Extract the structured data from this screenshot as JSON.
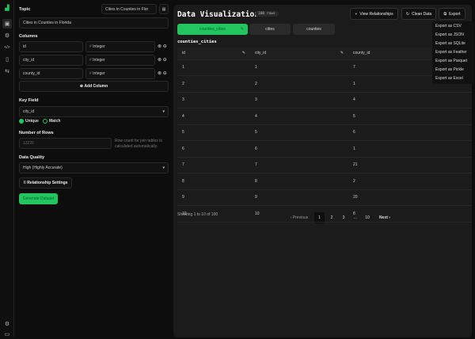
{
  "sidebar": {
    "icons": [
      "logo-icon",
      "terminal-icon",
      "robot-icon",
      "code-icon",
      "book-icon",
      "sliders-icon",
      "gear-icon",
      "panel-icon"
    ]
  },
  "config": {
    "topic_label": "Topic",
    "topic_select": "Cities in Counties in Flor",
    "topic_value": "Cities in Counties in Florida",
    "columns_label": "Columns",
    "columns": [
      {
        "name": "id",
        "type": "Integer"
      },
      {
        "name": "city_id",
        "type": "Integer"
      },
      {
        "name": "county_id",
        "type": "Integer"
      }
    ],
    "add_column": "Add Column",
    "key_field_label": "Key Field",
    "key_field_value": "city_id",
    "radio_unique": "Unique",
    "radio_match": "Match",
    "rows_label": "Number of Rows",
    "rows_placeholder": "13226",
    "rows_note": "Row count for join tables is calculated automatically.",
    "quality_label": "Data Quality",
    "quality_value": "High (Highly Accurate)",
    "relationship_settings": "Relationship Settings",
    "generate": "Generate Dataset"
  },
  "main": {
    "title": "Data Visualization",
    "rows_badge": "100 rows",
    "view_relationships": "View Relationships",
    "clean_data": "Clean Data",
    "export": "Export",
    "export_menu": [
      "Export as CSV",
      "Export as JSON",
      "Export as SQLite",
      "Export as Feather",
      "Export as Parquet",
      "Export as Pickle",
      "Export as Excel"
    ],
    "tabs": [
      "counties_cities",
      "cities",
      "counties"
    ],
    "table_title": "counties_cities",
    "headers": [
      "id",
      "city_id",
      "county_id"
    ],
    "rows": [
      [
        "1",
        "1",
        "7"
      ],
      [
        "2",
        "2",
        "1"
      ],
      [
        "3",
        "3",
        "4"
      ],
      [
        "4",
        "4",
        "5"
      ],
      [
        "5",
        "5",
        "6"
      ],
      [
        "6",
        "6",
        "1"
      ],
      [
        "7",
        "7",
        "21"
      ],
      [
        "8",
        "8",
        "2"
      ],
      [
        "9",
        "9",
        "20"
      ],
      [
        "10",
        "10",
        "8"
      ]
    ],
    "showing": "Showing 1 to 10 of 100",
    "pagination": {
      "previous": "Previous",
      "pages": [
        "1",
        "2",
        "3",
        "...",
        "10"
      ],
      "next": "Next"
    }
  },
  "colors": {
    "accent": "#22c55e"
  }
}
